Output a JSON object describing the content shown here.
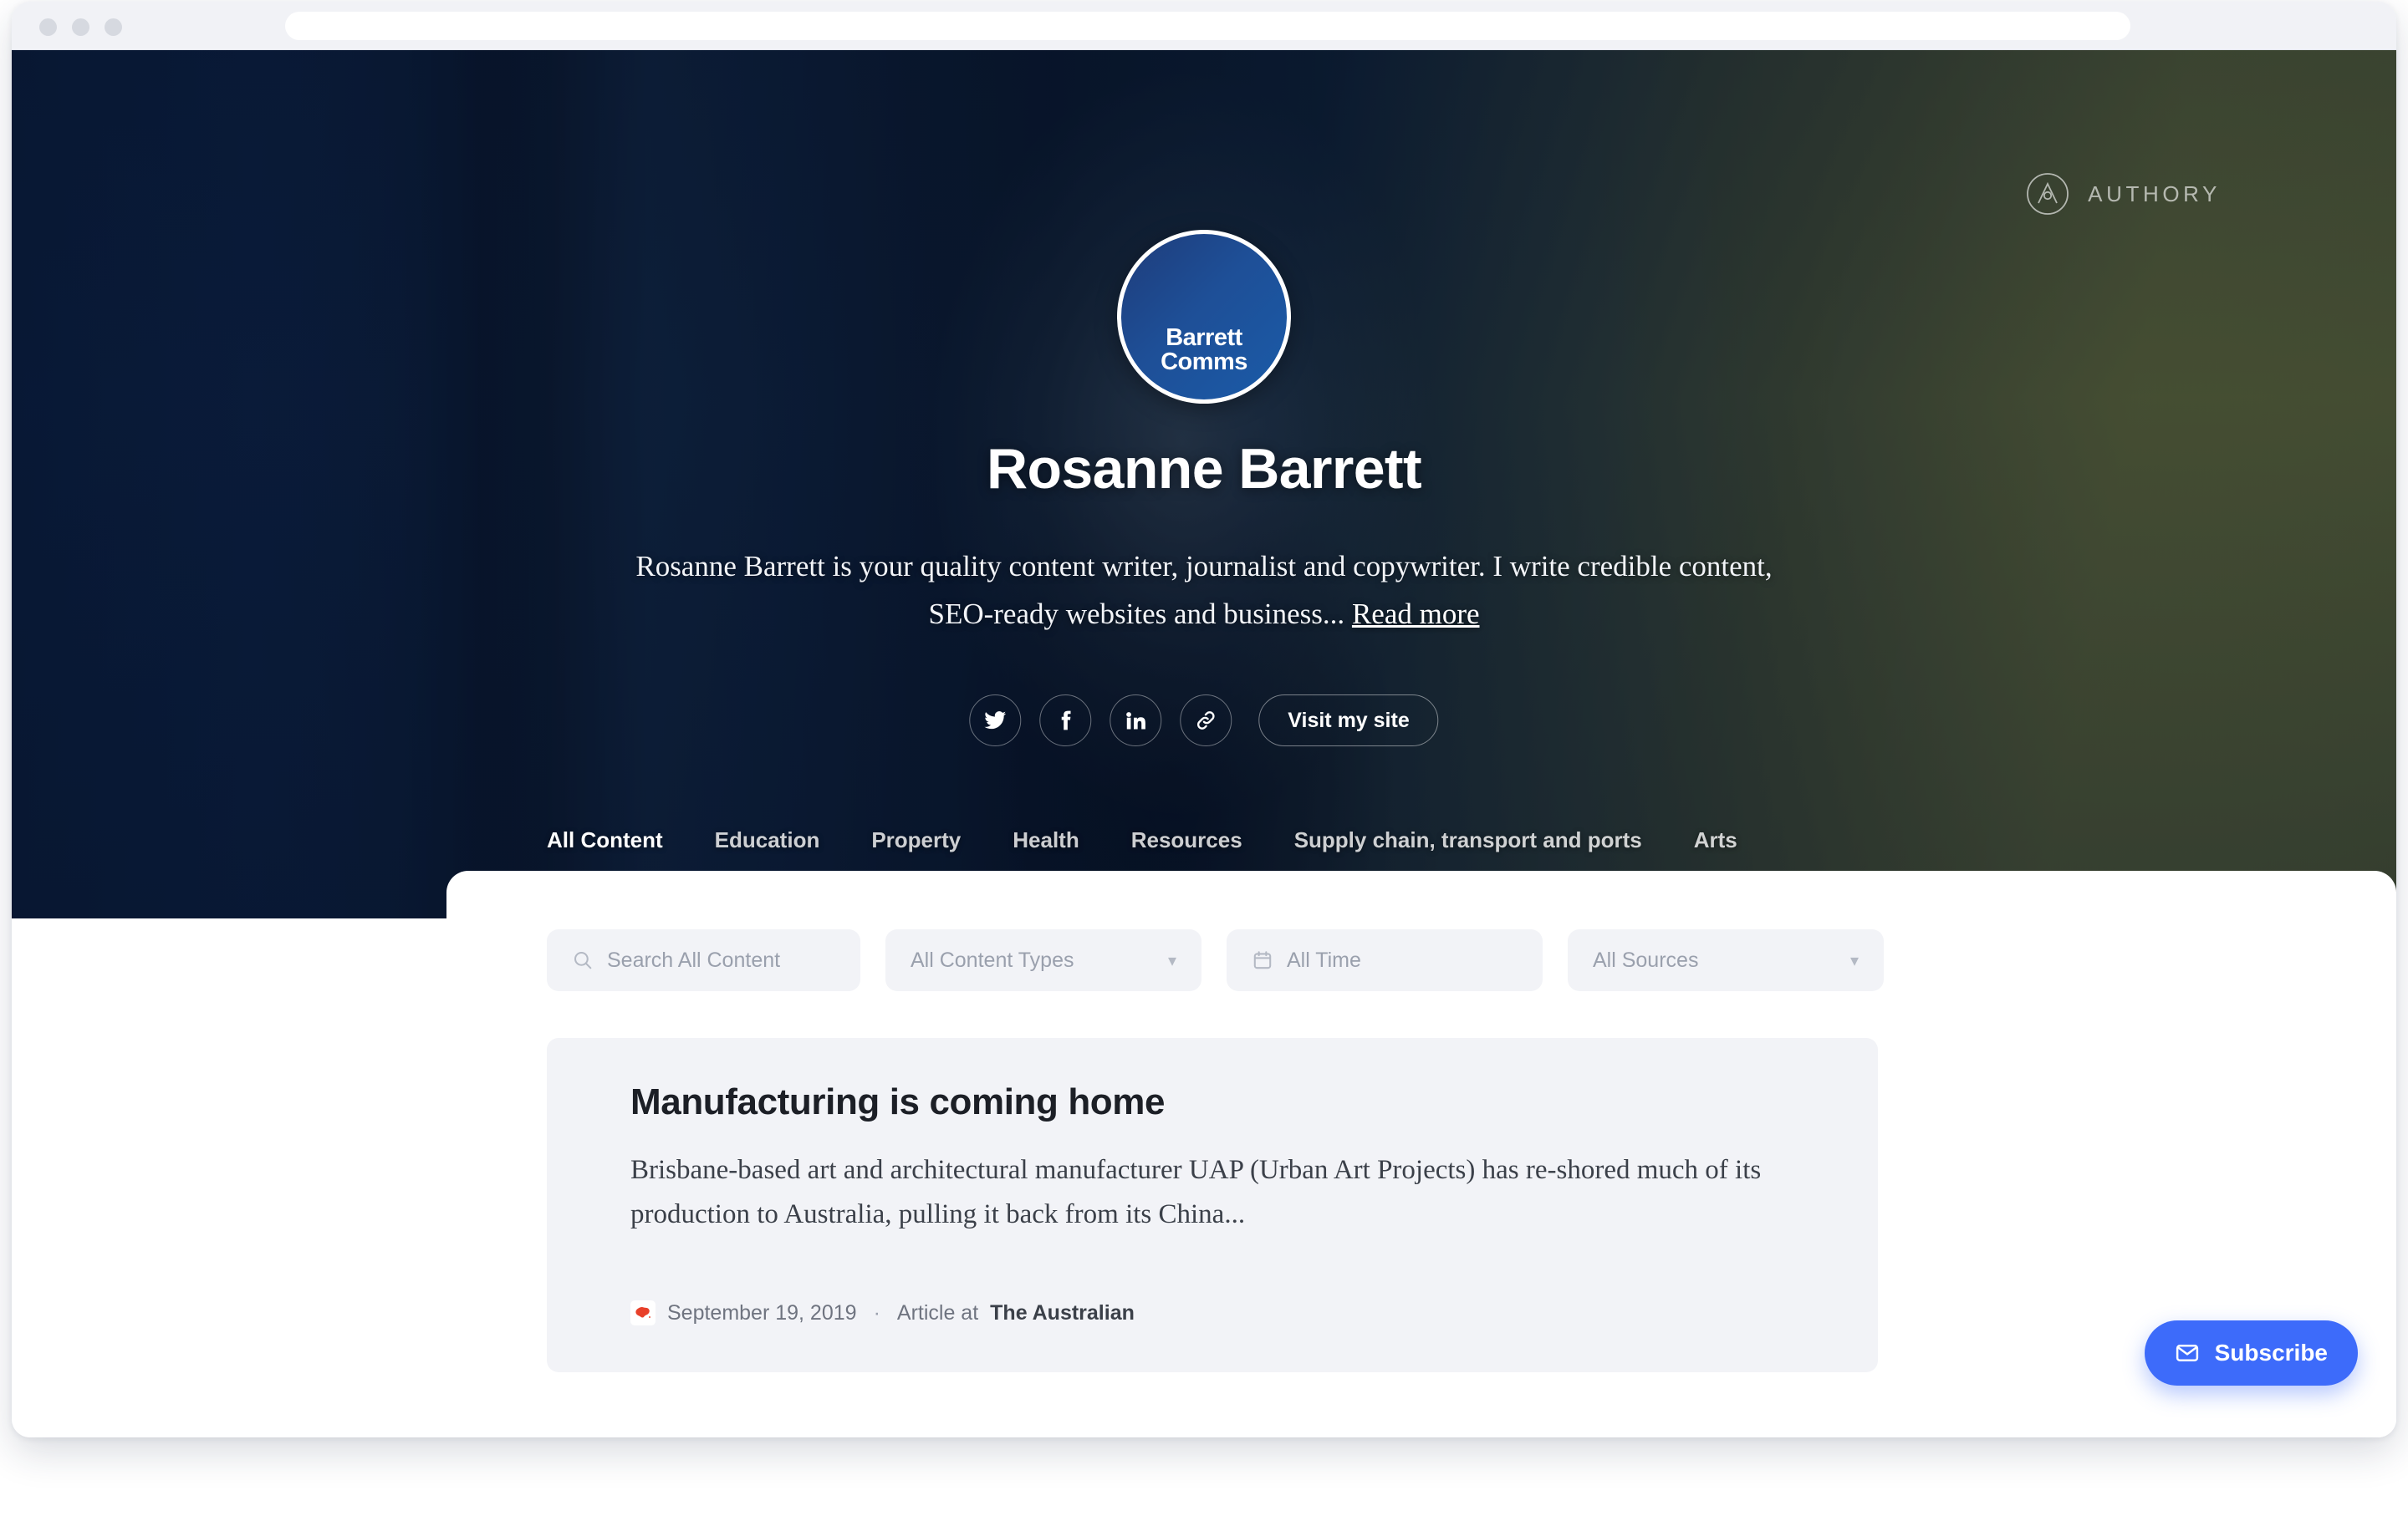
{
  "browser": {
    "address_bar_value": "",
    "address_bar_placeholder": ""
  },
  "hero": {
    "authory_wordmark": "AUTHORY",
    "avatar_logo_text": "Barrett\nComms",
    "profile_name": "Rosanne Barrett",
    "bio_text": "Rosanne Barrett is your quality content writer, journalist and copywriter. I write credible content, SEO-ready websites and business...",
    "bio_readmore_label": "Read more",
    "visit_site_label": "Visit my site",
    "social_links": [
      {
        "name": "twitter",
        "icon": "twitter-icon"
      },
      {
        "name": "facebook",
        "icon": "facebook-icon"
      },
      {
        "name": "linkedin",
        "icon": "linkedin-icon"
      },
      {
        "name": "website",
        "icon": "link-icon"
      }
    ]
  },
  "tabs": [
    {
      "label": "All Content",
      "active": true
    },
    {
      "label": "Education",
      "active": false
    },
    {
      "label": "Property",
      "active": false
    },
    {
      "label": "Health",
      "active": false
    },
    {
      "label": "Resources",
      "active": false
    },
    {
      "label": "Supply chain, transport and ports",
      "active": false
    },
    {
      "label": "Arts",
      "active": false
    }
  ],
  "filters": {
    "search_placeholder": "Search All Content",
    "search_value": "",
    "content_type_value": "All Content Types",
    "time_value": "All Time",
    "sources_value": "All Sources"
  },
  "articles": [
    {
      "title": "Manufacturing is coming home",
      "excerpt": "Brisbane-based art and architectural manufacturer UAP (Urban Art Projects) has re-shored much of its production to Australia, pulling it back from its China...",
      "date": "September 19, 2019",
      "separator": "·",
      "type_prefix": "Article at",
      "source": "The Australian"
    }
  ],
  "subscribe": {
    "label": "Subscribe"
  },
  "colors": {
    "accent_blue": "#3d6bfa",
    "hero_navy": "#0a1e40",
    "hero_olive": "#6e7a3d",
    "card_bg": "#f2f3f7",
    "muted_text": "#9aa0ad"
  }
}
